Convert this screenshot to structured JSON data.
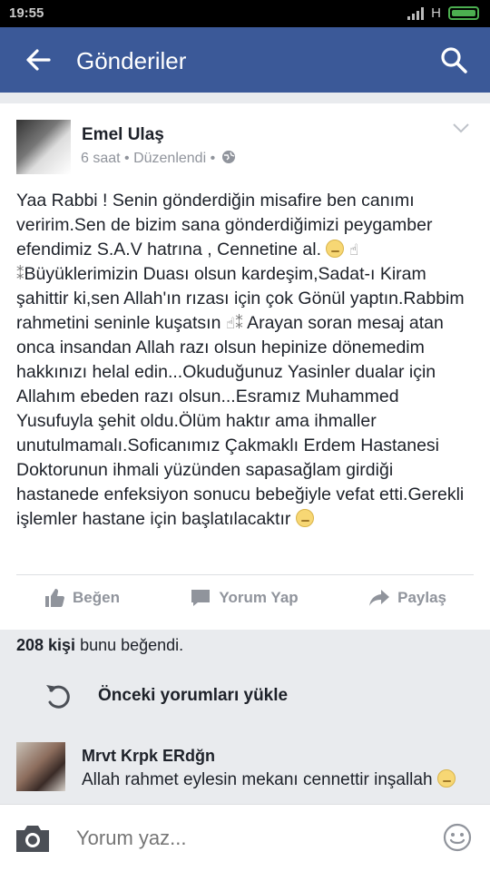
{
  "status": {
    "time": "19:55",
    "network": "H"
  },
  "header": {
    "title": "Gönderiler",
    "back_icon": "arrow-left-icon",
    "search_icon": "search-icon"
  },
  "post": {
    "author": "Emel Ulaş",
    "meta": "6 saat • Düzenlendi •",
    "text_part1": "Yaa Rabbi ! Senin gönderdiğin misafire ben canımı veririm.Sen de bizim sana gönderdiğimizi peygamber efendimiz S.A.V hatrına , Cennetine al.",
    "text_part2": "Büyüklerimizin Duası olsun kardeşim,Sadat-ı Kiram şahittir ki,sen Allah'ın rızası için çok Gönül yaptın.Rabbim rahmetini seninle kuşatsın",
    "text_part3": "Arayan soran mesaj atan onca insandan Allah razı olsun hepinize dönemedim hakkınızı helal edin...Okuduğunuz Yasinler dualar için Allahım ebeden razı olsun...Esramız Muhammed Yusufuyla şehit oldu.Ölüm haktır ama ihmaller unutulmamalı.Soficanımız Çakmaklı Erdem Hastanesi Doktorunun ihmali yüzünden sapasağlam girdiği hastanede enfeksiyon sonucu bebeğiyle vefat etti.Gerekli işlemler hastane için başlatılacaktır"
  },
  "actions": {
    "like": "Beğen",
    "comment": "Yorum Yap",
    "share": "Paylaş"
  },
  "likes": {
    "count": "208 kişi",
    "suffix": " bunu beğendi."
  },
  "previous_comments": "Önceki yorumları yükle",
  "comment": {
    "author": "Mrvt Krpk ERdğn",
    "text": "Allah rahmet eylesin mekanı cennettir inşallah"
  },
  "composer": {
    "placeholder": "Yorum yaz..."
  },
  "colors": {
    "brand": "#3b5998",
    "muted": "#90949c",
    "text": "#1d2129"
  }
}
